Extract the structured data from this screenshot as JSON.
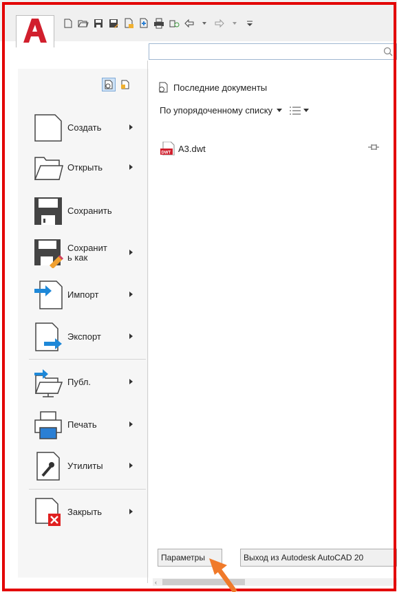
{
  "app": {
    "logo_letter": "A",
    "brand_color": "#d11f2d"
  },
  "quick_access": {
    "icons": [
      "new-icon",
      "open-icon",
      "save-icon",
      "save-as-icon",
      "open-from-web-icon",
      "save-to-web-icon",
      "plot-icon",
      "share-icon",
      "undo-icon",
      "redo-icon",
      "customize-icon"
    ]
  },
  "search": {
    "placeholder": ""
  },
  "left_menu": {
    "items": [
      {
        "label": "Создать",
        "has_arrow": true
      },
      {
        "label": "Открыть",
        "has_arrow": true
      },
      {
        "label": "Сохранить",
        "has_arrow": false
      },
      {
        "label": "Сохранить как",
        "label_display": "Сохранит\nь как",
        "has_arrow": true
      },
      {
        "label": "Импорт",
        "has_arrow": true
      },
      {
        "label": "Экспорт",
        "has_arrow": true
      },
      {
        "label": "Публ.",
        "has_arrow": true
      },
      {
        "label": "Печать",
        "has_arrow": true
      },
      {
        "label": "Утилиты",
        "has_arrow": true
      },
      {
        "label": "Закрыть",
        "has_arrow": true
      }
    ]
  },
  "recent": {
    "title": "Последние документы",
    "sort_label": "По упорядоченному списку",
    "files": [
      {
        "name": "А3.dwt",
        "type": "DWT"
      }
    ]
  },
  "footer": {
    "options_button": "Параметры",
    "exit_button": "Выход из Autodesk AutoCAD 20"
  },
  "annotation": {
    "frame_color": "#e30000",
    "arrow_color": "#f07a2a"
  }
}
